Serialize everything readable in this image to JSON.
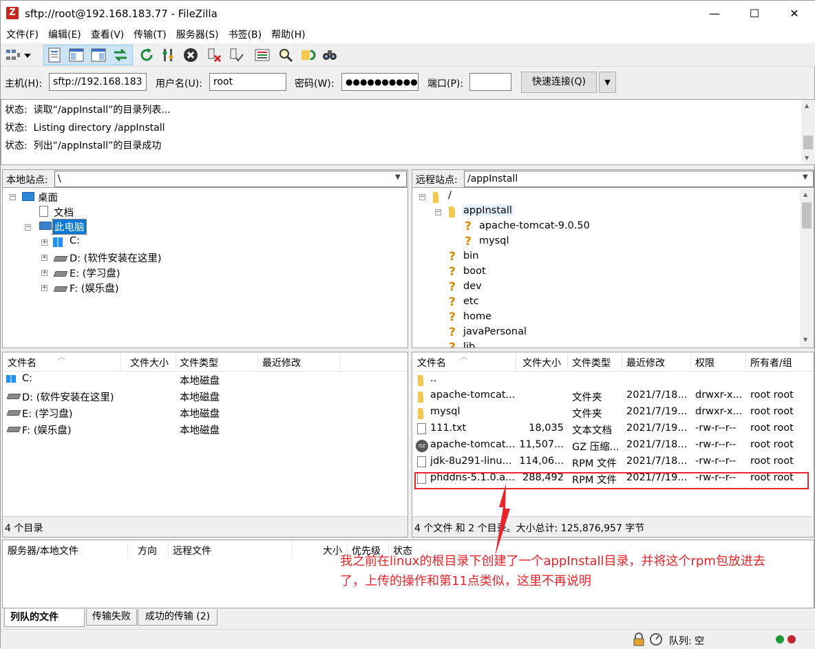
{
  "window": {
    "title": "sftp://root@192.168.183.77 - FileZilla",
    "min": "—",
    "max": "☐",
    "close": "✕"
  },
  "menu": [
    "文件(F)",
    "编辑(E)",
    "查看(V)",
    "传输(T)",
    "服务器(S)",
    "书签(B)",
    "帮助(H)"
  ],
  "toolbar": {
    "icons": [
      "site-manager-icon",
      "dropdown-arrow-icon",
      "toggle-log-icon",
      "toggle-local-tree-icon",
      "toggle-remote-tree-icon",
      "toggle-queue-icon",
      "refresh-icon",
      "process-queue-icon",
      "cancel-icon",
      "disconnect-icon",
      "reconnect-icon",
      "directory-compare-icon",
      "filter-icon",
      "sync-browse-icon",
      "search-icon"
    ]
  },
  "quickconnect": {
    "host_label": "主机(H):",
    "host_value": "sftp://192.168.183",
    "user_label": "用户名(U):",
    "user_value": "root",
    "pass_label": "密码(W):",
    "pass_value": "●●●●●●●●●●",
    "port_label": "端口(P):",
    "port_value": "",
    "connect_label": "快速连接(Q)",
    "dropdown": "▼"
  },
  "log": [
    {
      "label": "状态:",
      "text": "读取“/appInstall”的目录列表..."
    },
    {
      "label": "状态:",
      "text": "Listing directory /appInstall"
    },
    {
      "label": "状态:",
      "text": "列出“/appInstall”的目录成功"
    }
  ],
  "local": {
    "site_label": "本地站点:",
    "site_path": "\\",
    "tree": [
      "桌面",
      "文档",
      "此电脑",
      "C:",
      "D: (软件安装在这里)",
      "E: (学习盘)",
      "F: (娱乐盘)"
    ],
    "columns": [
      "文件名",
      "文件大小",
      "文件类型",
      "最近修改"
    ],
    "files": [
      {
        "name": "C:",
        "type": "本地磁盘"
      },
      {
        "name": "D: (软件安装在这里)",
        "type": "本地磁盘"
      },
      {
        "name": "E: (学习盘)",
        "type": "本地磁盘"
      },
      {
        "name": "F: (娱乐盘)",
        "type": "本地磁盘"
      }
    ],
    "status": "4 个目录"
  },
  "remote": {
    "site_label": "远程站点:",
    "site_path": "/appInstall",
    "tree": [
      "/",
      "appInstall",
      "apache-tomcat-9.0.50",
      "mysql",
      "bin",
      "boot",
      "dev",
      "etc",
      "home",
      "javaPersonal",
      "lib"
    ],
    "columns": [
      "文件名",
      "文件大小",
      "文件类型",
      "最近修改",
      "权限",
      "所有者/组"
    ],
    "files": [
      {
        "name": "..",
        "size": "",
        "type": "",
        "modified": "",
        "perm": "",
        "owner": ""
      },
      {
        "name": "apache-tomcat...",
        "size": "",
        "type": "文件夹",
        "modified": "2021/7/18...",
        "perm": "drwxr-x...",
        "owner": "root root"
      },
      {
        "name": "mysql",
        "size": "",
        "type": "文件夹",
        "modified": "2021/7/19...",
        "perm": "drwxr-x...",
        "owner": "root root"
      },
      {
        "name": "111.txt",
        "size": "18,035",
        "type": "文本文档",
        "modified": "2021/7/19...",
        "perm": "-rw-r--r--",
        "owner": "root root"
      },
      {
        "name": "apache-tomcat...",
        "size": "11,507...",
        "type": "GZ 压缩...",
        "modified": "2021/7/18...",
        "perm": "-rw-r--r--",
        "owner": "root root"
      },
      {
        "name": "jdk-8u291-linu...",
        "size": "114,06...",
        "type": "RPM 文件",
        "modified": "2021/7/18...",
        "perm": "-rw-r--r--",
        "owner": "root root"
      },
      {
        "name": "phddns-5.1.0.a...",
        "size": "288,492",
        "type": "RPM 文件",
        "modified": "2021/7/19...",
        "perm": "-rw-r--r--",
        "owner": "root root"
      }
    ],
    "status": "4 个文件 和 2 个目录。大小总计: 125,876,957 字节"
  },
  "queue": {
    "columns": [
      "服务器/本地文件",
      "方向",
      "远程文件",
      "大小",
      "优先级",
      "状态"
    ],
    "tabs": [
      "列队的文件",
      "传输失败",
      "成功的传输 (2)"
    ]
  },
  "annotation": {
    "text1": "我之前在linux的根目录下创建了一个appInstall目录，并将这个rpm包放进去",
    "text2": "了，上传的操作和第11点类似，这里不再说明",
    "color": "#e8232a"
  },
  "bottom_status": {
    "queue": "队列: 空"
  }
}
